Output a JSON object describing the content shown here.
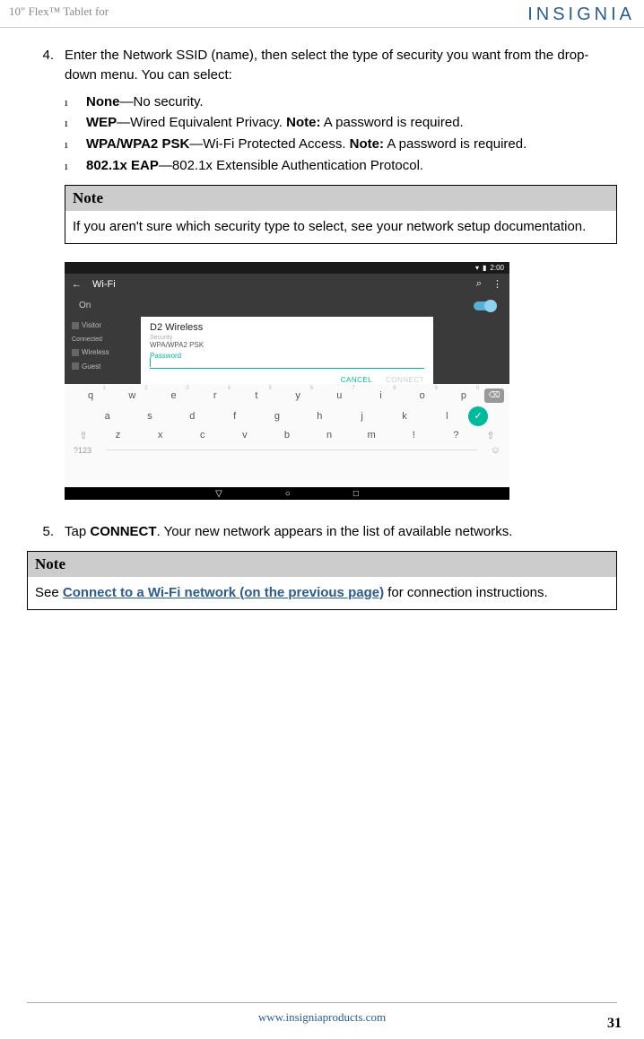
{
  "header": {
    "left": "10\" Flex™ Tablet for",
    "brand": "INSIGNIA"
  },
  "step4": {
    "num": "4.",
    "text_a": "Enter the Network SSID (name), then select the type of security you want from the drop-down menu. You can select:"
  },
  "bullets": [
    {
      "bold": "None",
      "rest": "—No security."
    },
    {
      "bold": "WEP",
      "rest": "—Wired Equivalent Privacy. ",
      "note_label": "Note:",
      "note_rest": " A password is required."
    },
    {
      "bold": "WPA/WPA2 PSK",
      "rest": "—Wi-Fi Protected Access. ",
      "note_label": "Note:",
      "note_rest": " A password is required."
    },
    {
      "bold": "802.1x EAP",
      "rest": "—802.1x Extensible Authentication Protocol."
    }
  ],
  "note1": {
    "header": "Note",
    "body": "If you aren't sure which security type to select, see your network setup documentation."
  },
  "screenshot": {
    "time": "2:00",
    "title": "Wi-Fi",
    "on": "On",
    "sidebar": [
      "Visitor",
      "Connected",
      "Wireless",
      "Guest"
    ],
    "dialog": {
      "title": "D2 Wireless",
      "sec_label": "Security",
      "sec_val": "WPA/WPA2 PSK",
      "pass_label": "Password",
      "cancel": "CANCEL",
      "connect": "CONNECT"
    },
    "keyboard": {
      "row1": [
        "q",
        "w",
        "e",
        "r",
        "t",
        "y",
        "u",
        "i",
        "o",
        "p"
      ],
      "row1_sup": [
        "1",
        "2",
        "3",
        "4",
        "5",
        "6",
        "7",
        "8",
        "9",
        "0"
      ],
      "row2": [
        "a",
        "s",
        "d",
        "f",
        "g",
        "h",
        "j",
        "k",
        "l"
      ],
      "row3": [
        "z",
        "x",
        "c",
        "v",
        "b",
        "n",
        "m",
        "!",
        "?"
      ],
      "numkey": "?123"
    }
  },
  "step5": {
    "num": "5.",
    "pre": "Tap ",
    "bold": "CONNECT",
    "post": ". Your new network appears in the list of available networks."
  },
  "note2": {
    "header": "Note",
    "pre": "See ",
    "link": "Connect to a Wi-Fi network (on the previous page)",
    "post": " for connection instructions."
  },
  "footer": {
    "url": "www.insigniaproducts.com",
    "page": "31"
  }
}
